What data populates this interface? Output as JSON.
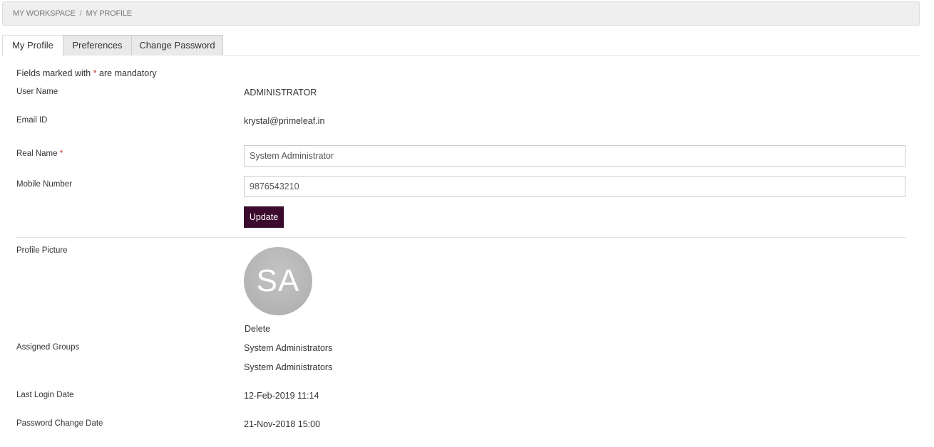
{
  "breadcrumb": {
    "items": [
      "MY WORKSPACE",
      "MY PROFILE"
    ],
    "separator": "/"
  },
  "tabs": [
    {
      "label": "My Profile",
      "active": true
    },
    {
      "label": "Preferences",
      "active": false
    },
    {
      "label": "Change Password",
      "active": false
    }
  ],
  "form": {
    "mandatory_note_pre": "Fields marked with ",
    "mandatory_marker": "*",
    "mandatory_note_post": " are mandatory",
    "user_name_label": "User Name",
    "user_name_value": "ADMINISTRATOR",
    "email_label": "Email ID",
    "email_value": "krystal@primeleaf.in",
    "real_name_label": "Real Name",
    "real_name_value": "System Administrator",
    "mobile_label": "Mobile Number",
    "mobile_value": "9876543210",
    "update_label": "Update"
  },
  "profile": {
    "picture_label": "Profile Picture",
    "avatar_initials": "SA",
    "delete_label": "Delete",
    "groups_label": "Assigned Groups",
    "groups": [
      "System Administrators",
      "System Administrators"
    ],
    "last_login_label": "Last Login Date",
    "last_login_value": "12-Feb-2019 11:14",
    "password_change_label": "Password Change Date",
    "password_change_value": "21-Nov-2018 15:00"
  },
  "colors": {
    "button_bg": "#3b0a2e",
    "required": "#c0392b",
    "avatar_bg": "#b5b5b5"
  }
}
